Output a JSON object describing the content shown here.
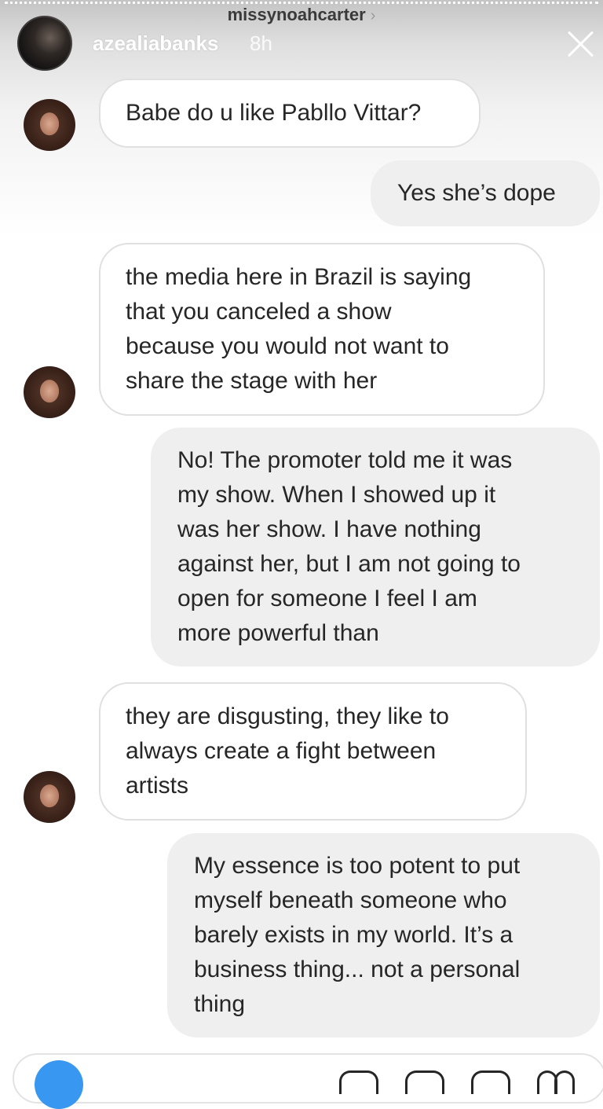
{
  "story_header": {
    "reply_to_username": "missynoahcarter",
    "reply_to_chevron": "›",
    "username": "azealiabanks",
    "time": "8h",
    "close_icon": "close-icon"
  },
  "messages": [
    {
      "direction": "incoming",
      "text": "Babe do u like Pabllo Vittar?"
    },
    {
      "direction": "outgoing",
      "text": "Yes she’s dope"
    },
    {
      "direction": "incoming",
      "text": "the media here in Brazil is saying\nthat you canceled a show\nbecause you would not want to\nshare the stage with her"
    },
    {
      "direction": "outgoing",
      "text": "No! The promoter told me it was\nmy show. When I showed up it\nwas her show. I have nothing\nagainst her, but I am not going to\nopen for someone I feel I am\nmore powerful than"
    },
    {
      "direction": "incoming",
      "text": "they are disgusting, they like to\nalways create a fight between\nartists"
    },
    {
      "direction": "outgoing",
      "text": "My essence is too potent to put\nmyself beneath someone who\nbarely exists in my world. It’s a\nbusiness thing... not a personal\nthing"
    }
  ],
  "composer": {
    "camera_icon": "camera-icon",
    "icons": [
      "microphone-icon",
      "gallery-icon",
      "sticker-icon",
      "heart-icon"
    ]
  },
  "colors": {
    "incoming_bubble": "#ffffff",
    "outgoing_bubble": "#efefef",
    "text": "#262626",
    "camera_button": "#3897f0"
  }
}
